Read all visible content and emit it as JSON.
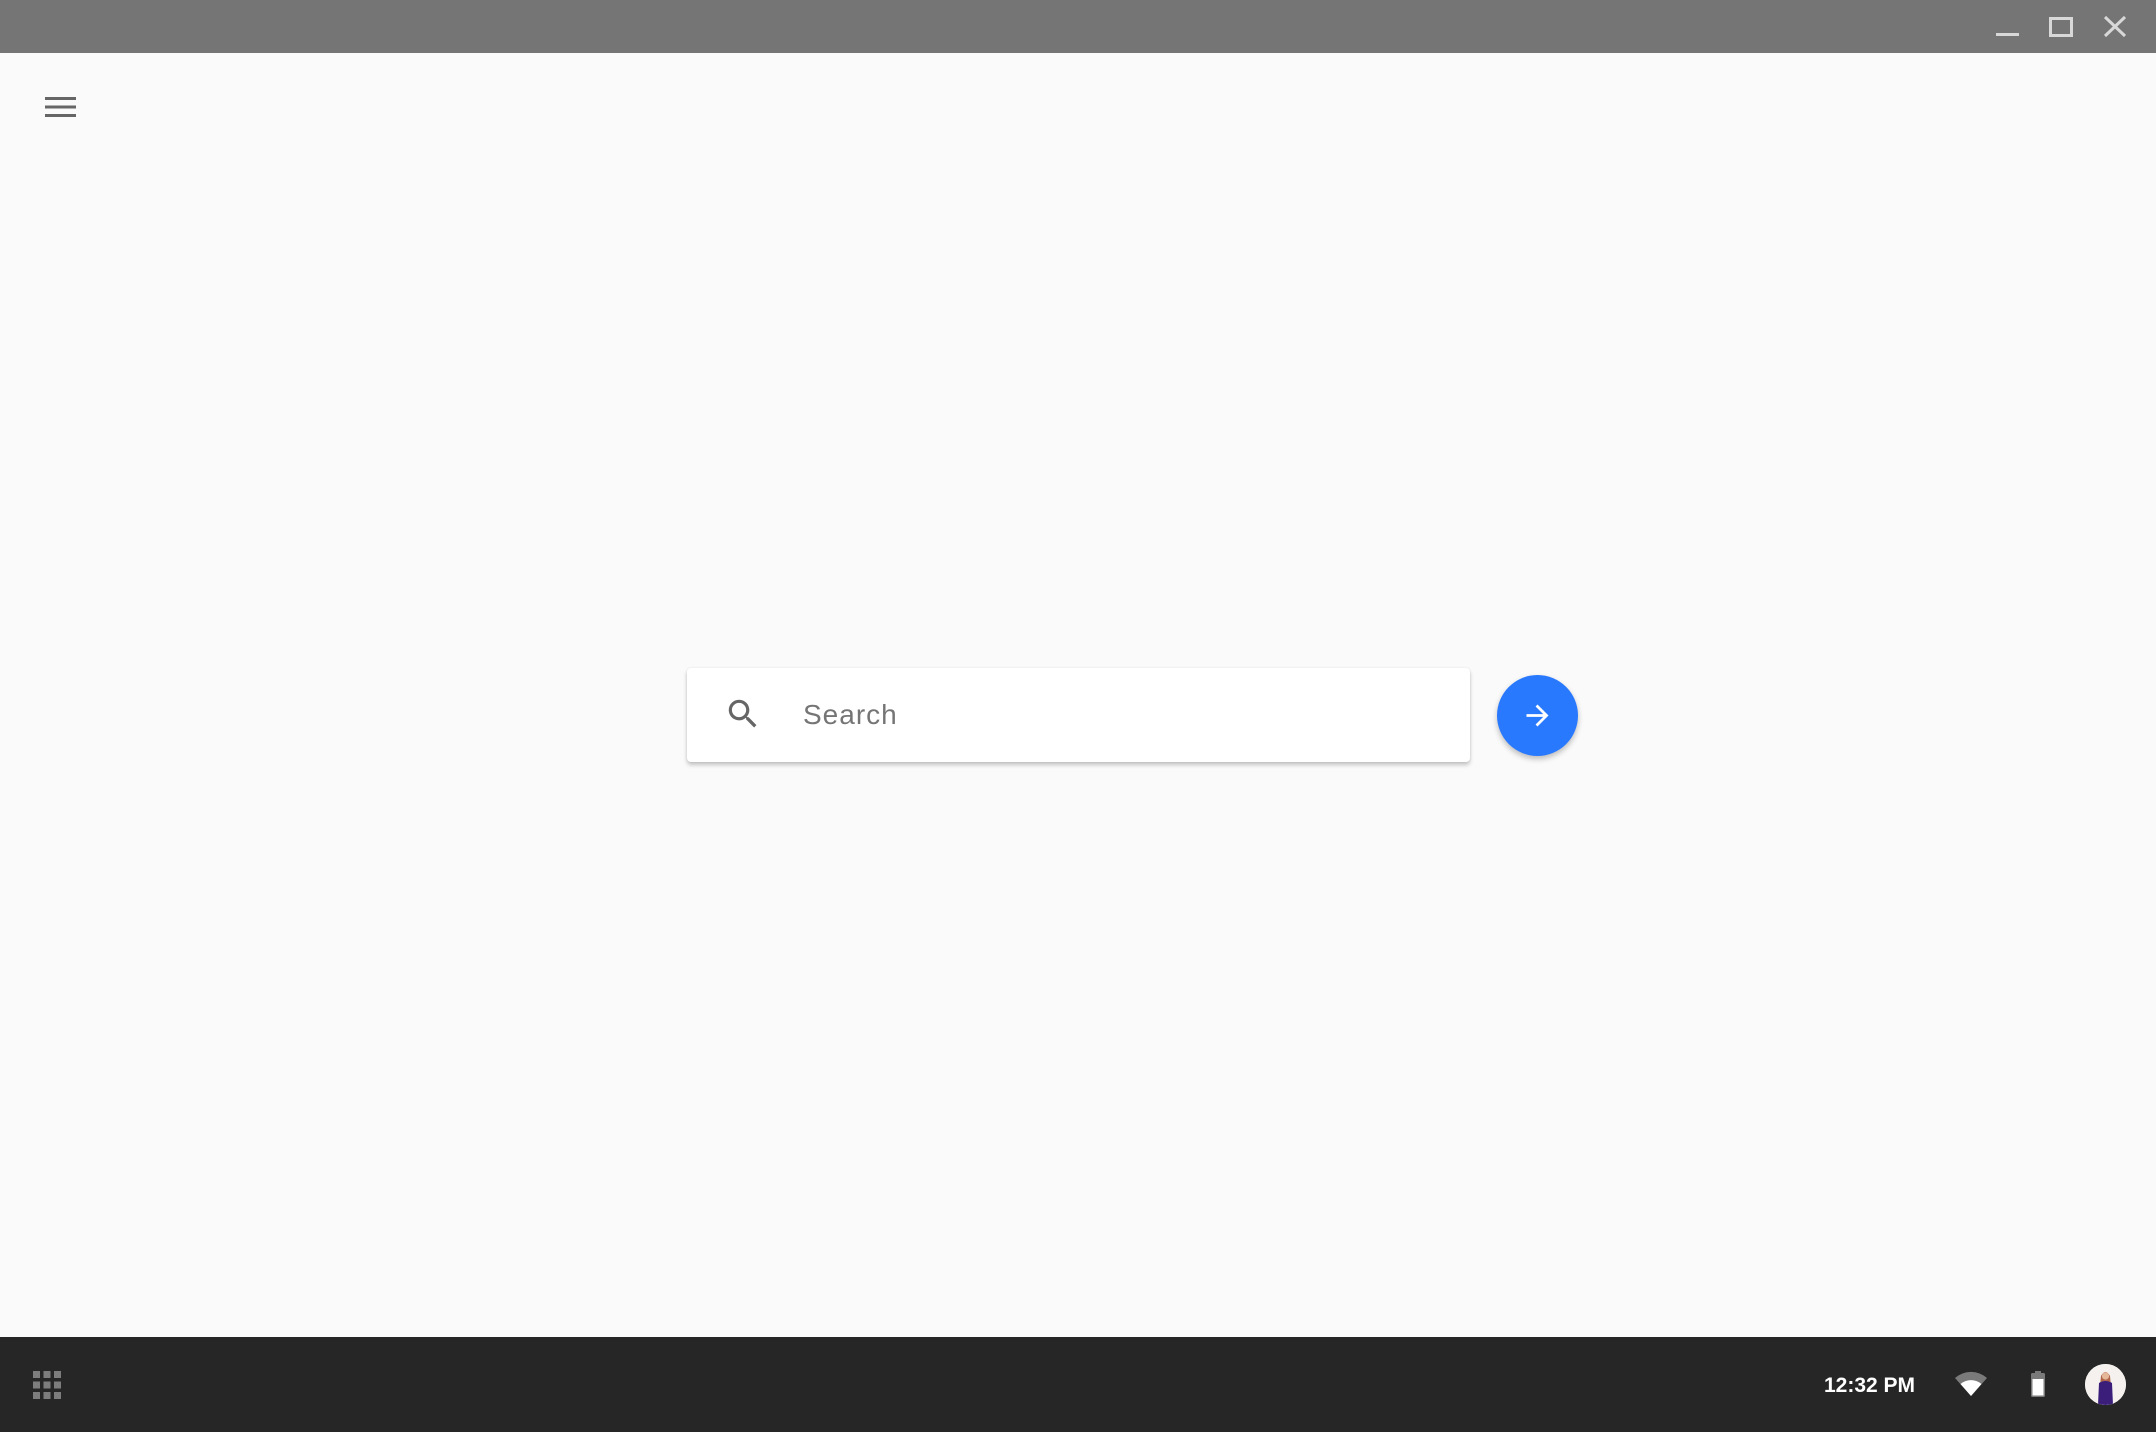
{
  "window": {
    "controls": {
      "minimize_icon": "minimize-icon",
      "maximize_icon": "maximize-icon",
      "close_icon": "close-icon"
    }
  },
  "app": {
    "menu_icon": "hamburger-menu-icon",
    "search": {
      "icon": "search-icon",
      "placeholder": "Search",
      "value": ""
    },
    "submit_icon": "arrow-right-icon"
  },
  "taskbar": {
    "launcher_icon": "app-launcher-grid-icon",
    "time": "12:32 PM",
    "wifi_icon": "wifi-icon",
    "battery_icon": "battery-icon",
    "avatar_icon": "user-avatar"
  },
  "colors": {
    "titlebar": "#757575",
    "background": "#fafafa",
    "accent": "#2979ff",
    "taskbar": "#262626"
  }
}
